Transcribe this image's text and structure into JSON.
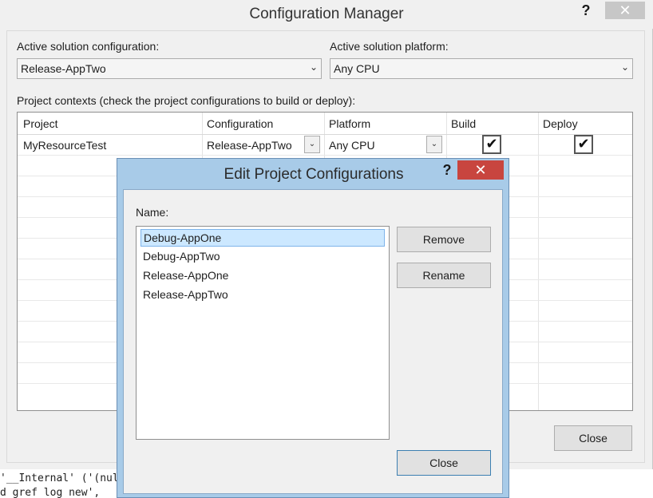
{
  "main": {
    "title": "Configuration Manager",
    "help_glyph": "?",
    "close_glyph": "✕",
    "active_config_label": "Active solution configuration:",
    "active_config_value": "Release-AppTwo",
    "active_platform_label": "Active solution platform:",
    "active_platform_value": "Any CPU",
    "contexts_label": "Project contexts (check the project configurations to build or deploy):",
    "columns": [
      "Project",
      "Configuration",
      "Platform",
      "Build",
      "Deploy"
    ],
    "row": {
      "project": "MyResourceTest",
      "configuration": "Release-AppTwo",
      "platform": "Any CPU",
      "build_checked": true,
      "deploy_checked": true,
      "check_glyph": "✔"
    },
    "close_button": "Close",
    "dropdown_glyph": "⌄"
  },
  "console": {
    "line1": "'__Internal' ('(nul",
    "line2": "d gref log new',"
  },
  "dialog": {
    "title": "Edit Project Configurations",
    "help_glyph": "?",
    "close_glyph": "✕",
    "name_label": "Name:",
    "items": [
      "Debug-AppOne",
      "Debug-AppTwo",
      "Release-AppOne",
      "Release-AppTwo"
    ],
    "selected_index": 0,
    "remove_button": "Remove",
    "rename_button": "Rename",
    "close_button": "Close"
  },
  "colors": {
    "dialog_frame": "#a8cbe8",
    "close_red": "#c8453f",
    "selection": "#cce8ff"
  }
}
